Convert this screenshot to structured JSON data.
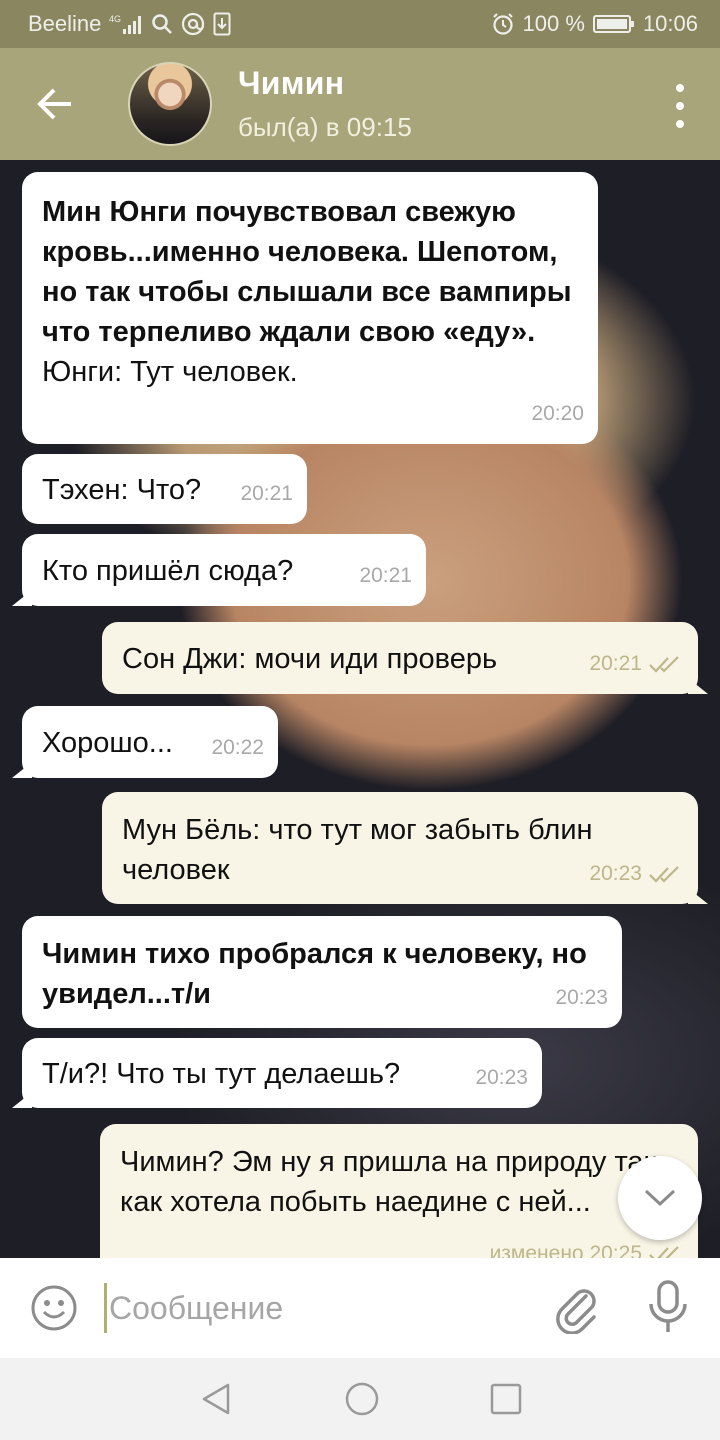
{
  "statusbar": {
    "carrier": "Beeline",
    "network": "4G",
    "battery": "100 %",
    "time": "10:06"
  },
  "header": {
    "contact_name": "Чимин",
    "last_seen": "был(а) в 09:15"
  },
  "messages": [
    {
      "side": "in",
      "bold": "Мин Юнги почувствовал свежую кровь...именно человека. Шепотом, но так чтобы слышали все вампиры что терпеливо ждали свою «еду».",
      "text": "Юнги: Тут человек.",
      "time": "20:20"
    },
    {
      "side": "in",
      "text": "Тэхен: Что?",
      "time": "20:21"
    },
    {
      "side": "in",
      "text": "Кто пришёл сюда?",
      "time": "20:21"
    },
    {
      "side": "out",
      "text": "Сон Джи: мочи иди проверь",
      "time": "20:21"
    },
    {
      "side": "in",
      "text": "Хорошо...",
      "time": "20:22"
    },
    {
      "side": "out",
      "text": "Мун Бёль: что тут мог забыть блин человек",
      "time": "20:23"
    },
    {
      "side": "in",
      "bold": "Чимин тихо пробрался к человеку, но увидел...т/и",
      "time": "20:23"
    },
    {
      "side": "in",
      "text": "Т/и?! Что ты тут делаешь?",
      "time": "20:23"
    },
    {
      "side": "out",
      "text": "Чимин? Эм ну я пришла на природу так как хотела побыть наедине с ней...",
      "time": "изменено 20:25"
    }
  ],
  "input": {
    "placeholder": "Сообщение"
  },
  "icons": {
    "back": "arrow-left-icon",
    "menu": "more-vertical-icon",
    "emoji": "smiley-icon",
    "attach": "paperclip-icon",
    "mic": "microphone-icon",
    "scroll": "chevron-down-icon"
  },
  "colors": {
    "header": "#a9a57a",
    "statusbar": "#8a8760",
    "outgoing_bubble": "#f8f5e6",
    "incoming_bubble": "#ffffff",
    "read_check": "#bdb68a"
  }
}
